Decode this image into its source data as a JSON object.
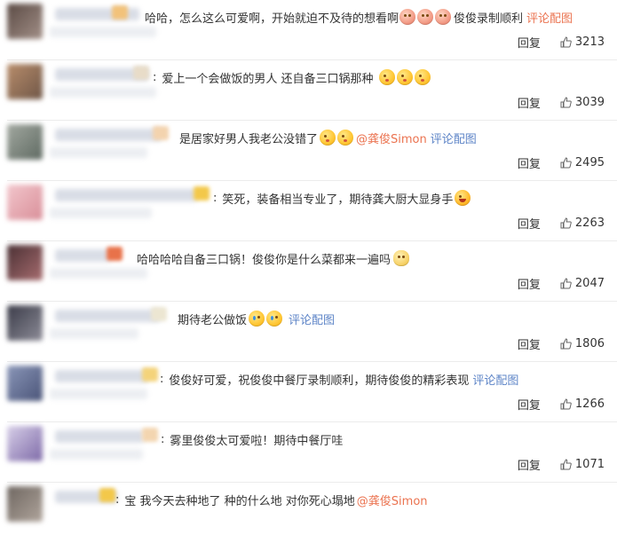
{
  "comments": [
    {
      "text": "哈哈，怎么这么可爱啊，开始就迫不及待的想看啊",
      "emojis": [
        "peach",
        "peach",
        "peach"
      ],
      "after_text": "俊俊录制顺利",
      "mention": "",
      "view_pic": "评论配图",
      "reply_label": "回复",
      "likes": "3213"
    },
    {
      "sep": ":",
      "text": "爱上一个会做饭的男人 还自备三口锅那种",
      "emojis": [
        "kiss",
        "kiss",
        "kiss"
      ],
      "after_text": "",
      "mention": "",
      "view_pic": "",
      "reply_label": "回复",
      "likes": "3039"
    },
    {
      "text": "是居家好男人我老公没错了",
      "emojis": [
        "kiss",
        "kiss"
      ],
      "after_text": "",
      "mention": "@龚俊Simon",
      "view_pic": "评论配图",
      "reply_label": "回复",
      "likes": "2495"
    },
    {
      "sep": ":",
      "text": "笑死，装备相当专业了，期待龚大厨大显身手",
      "emojis": [
        "laugh"
      ],
      "after_text": "",
      "mention": "",
      "view_pic": "",
      "reply_label": "回复",
      "likes": "2263"
    },
    {
      "text": "哈哈哈哈自备三口锅！俊俊你是什么菜都来一遍吗",
      "emojis": [
        "cat"
      ],
      "after_text": "",
      "mention": "",
      "view_pic": "",
      "reply_label": "回复",
      "likes": "2047"
    },
    {
      "text": "期待老公做饭",
      "emojis": [
        "cry",
        "cry"
      ],
      "after_text": "",
      "mention": "",
      "view_pic": "评论配图",
      "reply_label": "回复",
      "likes": "1806"
    },
    {
      "sep": ":",
      "text": "俊俊好可爱，祝俊俊中餐厅录制顺利，期待俊俊的精彩表现",
      "emojis": [],
      "after_text": "",
      "mention": "",
      "view_pic": "评论配图",
      "reply_label": "回复",
      "likes": "1266"
    },
    {
      "sep": ":",
      "text": "雾里俊俊太可爱啦！期待中餐厅哇",
      "emojis": [],
      "after_text": "",
      "mention": "",
      "view_pic": "",
      "reply_label": "回复",
      "likes": "1071"
    },
    {
      "sep": ":",
      "text": "宝 我今天去种地了 种的什么地 对你死心塌地",
      "emojis": [],
      "after_text": "",
      "mention": "@龚俊Simon",
      "view_pic": "",
      "reply_label": "",
      "likes": ""
    }
  ],
  "colors": {
    "link": "#eb7350",
    "pic_link": "#5d84c7",
    "text": "#333333",
    "divider": "#ececec"
  }
}
